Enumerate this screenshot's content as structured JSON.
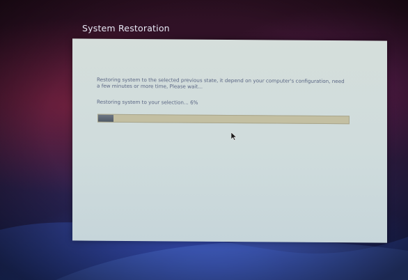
{
  "dialog": {
    "title": "System  Restoration",
    "message": "Restoring system to the selected previous state, it depend on your computer's configuration, need a few minutes or more time, Please wait...",
    "status": "Restoring system to your selection... 6%",
    "progress": 0.06
  },
  "colors": {
    "dialog_background": "#d3ddda",
    "progress_track": "#c3bfa2",
    "progress_fill": "#5f6975",
    "text": "#5a6684"
  }
}
